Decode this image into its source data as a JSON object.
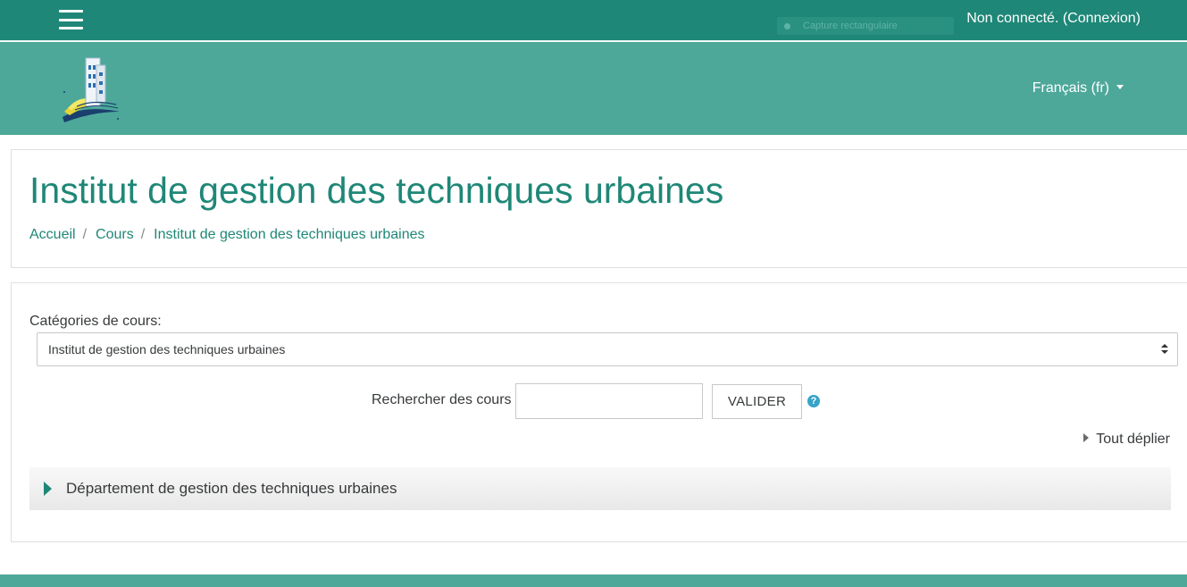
{
  "topbar": {
    "menu_icon": "hamburger-menu-icon",
    "capture_tool_label": "Capture rectangulaire",
    "login_text": "Non connecté. (Connexion)"
  },
  "brandbar": {
    "logo_icon": "institute-building-logo",
    "language": "Français (fr)"
  },
  "header": {
    "title": "Institut de gestion des techniques urbaines",
    "breadcrumb": [
      "Accueil",
      "Cours",
      "Institut de gestion des techniques urbaines"
    ]
  },
  "main": {
    "category_label": "Catégories de cours:",
    "category_selected": "Institut de gestion des techniques urbaines",
    "search_label": "Rechercher des cours",
    "search_value": "",
    "submit_label": "VALIDER",
    "help_icon": "question-circle-icon",
    "expand_all_label": "Tout déplier",
    "categories": [
      {
        "name": "Département de gestion des techniques urbaines"
      }
    ]
  },
  "colors": {
    "topbar": "#1f8777",
    "brandbar": "#4da89a",
    "accent_text": "#1f8777",
    "help_icon": "#36a3c7"
  }
}
